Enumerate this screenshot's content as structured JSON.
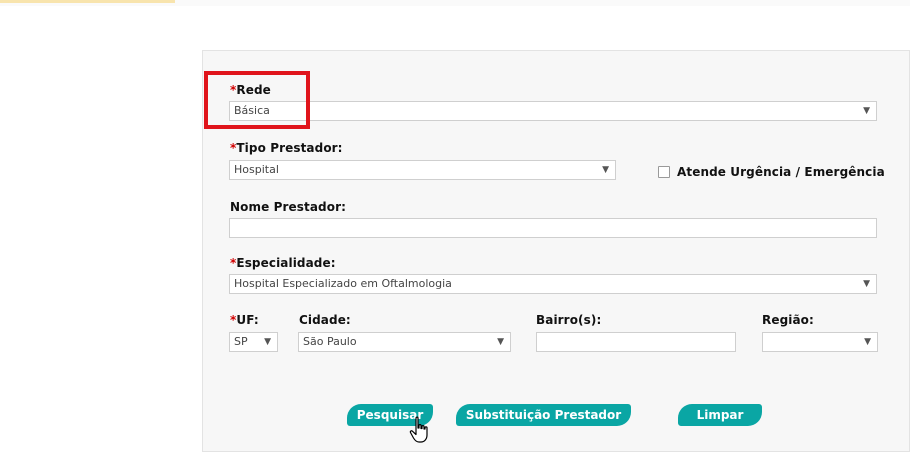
{
  "form": {
    "rede": {
      "label": "Rede",
      "value": "Básica"
    },
    "tipo_prestador": {
      "label": "Tipo Prestador:",
      "value": "Hospital"
    },
    "urgencia_checkbox": {
      "label": "Atende Urgência / Emergência",
      "checked": false
    },
    "nome_prestador": {
      "label": "Nome Prestador:",
      "value": ""
    },
    "especialidade": {
      "label": "Especialidade:",
      "value": "Hospital Especializado em Oftalmologia"
    },
    "uf": {
      "label": "UF:",
      "value": "SP"
    },
    "cidade": {
      "label": "Cidade:",
      "value": "São Paulo"
    },
    "bairro": {
      "label": "Bairro(s):",
      "value": ""
    },
    "regiao": {
      "label": "Região:",
      "value": ""
    },
    "required_marker": "*",
    "dropdown_arrow": "▼"
  },
  "buttons": {
    "pesquisar": "Pesquisar",
    "substituicao": "Substituição Prestador",
    "limpar": "Limpar"
  },
  "colors": {
    "button": "#0aa6a4",
    "highlight": "#e0141b",
    "required": "#d10000"
  }
}
